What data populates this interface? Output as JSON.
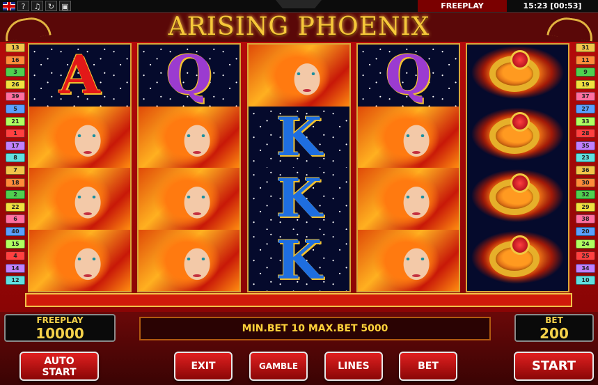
{
  "topbar": {
    "help": "?",
    "mode": "FREEPLAY",
    "clock": "15:23 [00:53]"
  },
  "game": {
    "title": "ARISING PHOENIX"
  },
  "lines": {
    "left": [
      "13",
      "16",
      "3",
      "26",
      "39",
      "5",
      "21",
      "1",
      "17",
      "8",
      "7",
      "18",
      "2",
      "22",
      "6",
      "40",
      "15",
      "4",
      "14",
      "12"
    ],
    "right": [
      "31",
      "11",
      "9",
      "19",
      "37",
      "27",
      "33",
      "28",
      "35",
      "23",
      "36",
      "30",
      "32",
      "29",
      "38",
      "20",
      "24",
      "25",
      "34",
      "10"
    ],
    "colors": [
      "#f2c44a",
      "#ff8a3a",
      "#4fd04f",
      "#f0e040",
      "#ff6fa0",
      "#5aa0ff",
      "#b0ff60",
      "#ff4040",
      "#c080ff",
      "#60e0e0"
    ]
  },
  "reels": [
    [
      "A",
      "phoenix",
      "phoenix",
      "phoenix"
    ],
    [
      "Q",
      "phoenix",
      "phoenix",
      "phoenix"
    ],
    [
      "phoenix",
      "K",
      "K",
      "K"
    ],
    [
      "Q",
      "phoenix",
      "phoenix",
      "phoenix"
    ],
    [
      "ring",
      "ring",
      "ring",
      "ring"
    ]
  ],
  "panel": {
    "freeplay_label": "FREEPLAY",
    "freeplay_value": "10000",
    "ticker": "MIN.BET 10 MAX.BET 5000",
    "bet_label": "BET",
    "bet_value": "200",
    "buttons": {
      "auto_start_line1": "AUTO",
      "auto_start_line2": "START",
      "exit": "EXIT",
      "gamble": "GAMBLE",
      "lines": "LINES",
      "bet": "BET",
      "start": "START"
    }
  }
}
